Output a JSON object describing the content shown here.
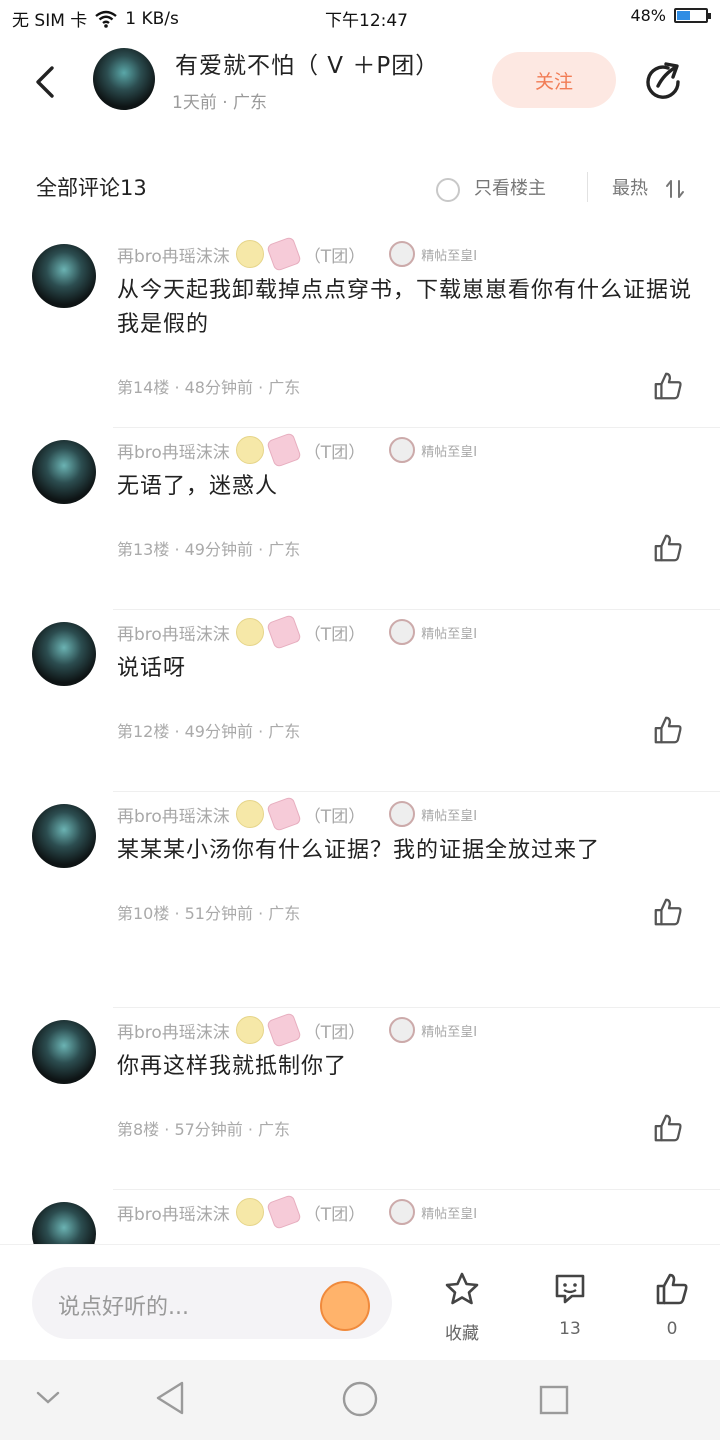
{
  "status_bar": {
    "left": "无 SIM 卡",
    "speed": "1 KB/s",
    "time": "下午12:47",
    "battery_percent": "48%",
    "battery_level": 0.48
  },
  "header": {
    "back_icon": "chevron-left-icon",
    "title": "有爱就不怕（ V ＋P团）",
    "subtitle": "1天前 · 广东",
    "follow_label": "关注",
    "share_icon": "share-icon"
  },
  "comments_bar": {
    "all_comments": "全部评论13",
    "only_op": "只看楼主",
    "sort": "最热"
  },
  "comments": [
    {
      "user": "再bro冉瑶沫沫",
      "tag": "（T团）",
      "badge": "精帖至皇Ⅰ",
      "content": "从今天起我卸载掉点点穿书，下载崽崽看你有什么证据说我是假的",
      "meta": "第14楼 · 48分钟前 · 广东"
    },
    {
      "user": "再bro冉瑶沫沫",
      "tag": "（T团）",
      "badge": "精帖至皇Ⅰ",
      "content": "无语了，迷惑人",
      "meta": "第13楼 · 49分钟前 · 广东"
    },
    {
      "user": "再bro冉瑶沫沫",
      "tag": "（T团）",
      "badge": "精帖至皇Ⅰ",
      "content": "说话呀",
      "meta": "第12楼 · 49分钟前 · 广东"
    },
    {
      "user": "再bro冉瑶沫沫",
      "tag": "（T团）",
      "badge": "精帖至皇Ⅰ",
      "content": "某某某小汤你有什么证据？我的证据全放过来了",
      "meta": "第10楼 · 51分钟前 · 广东"
    },
    {
      "user": "再bro冉瑶沫沫",
      "tag": "（T团）",
      "badge": "精帖至皇Ⅰ",
      "content": "你再这样我就抵制你了",
      "meta": "第8楼 · 57分钟前 · 广东"
    },
    {
      "user": "再bro冉瑶沫沫",
      "tag": "（T团）",
      "badge": "精帖至皇Ⅰ",
      "content": "",
      "meta": ""
    }
  ],
  "footer": {
    "input_placeholder": "说点好听的...",
    "favorite_label": "收藏",
    "comment_count": "13",
    "like_count": "0"
  },
  "colors": {
    "accent": "#f17c55",
    "follow_bg": "#fde8e2",
    "battery": "#2f8de4"
  }
}
